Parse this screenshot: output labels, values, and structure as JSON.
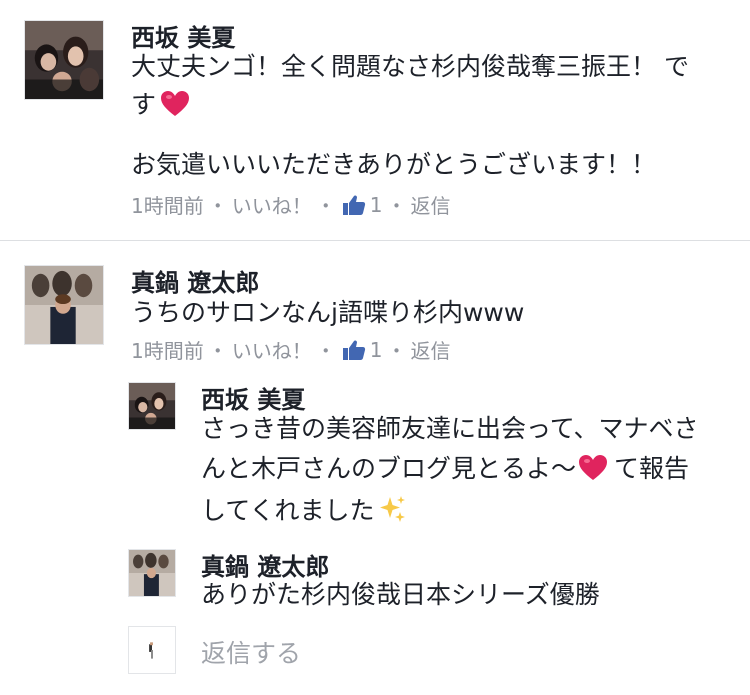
{
  "comments": [
    {
      "author": "西坂 美夏",
      "lines": [
        "大丈夫ンゴ！全く問題なさ杉内俊哉奪三振王！ で",
        "す",
        "お気遣いいいただきありがとうございます！！"
      ],
      "meta": {
        "time": "1時間前",
        "like": "いいね！",
        "like_count": "1",
        "reply": "返信"
      },
      "avatar_icon": "profile-photo"
    },
    {
      "author": "真鍋 遼太郎",
      "lines": [
        "うちのサロンなんj語喋り杉内www"
      ],
      "meta": {
        "time": "1時間前",
        "like": "いいね！",
        "like_count": "1",
        "reply": "返信"
      },
      "avatar_icon": "profile-photo",
      "replies": [
        {
          "author": "西坂 美夏",
          "lines": [
            "さっき昔の美容師友達に出会って、マナベさ",
            "んと木戸さんのブログ見とるよ〜",
            "て報告",
            "してくれました"
          ]
        },
        {
          "author": "真鍋 遼太郎",
          "lines": [
            "ありがた杉内俊哉日本シリーズ優勝"
          ]
        }
      ]
    }
  ],
  "reply_box": {
    "placeholder": "返信する"
  },
  "colors": {
    "meta": "#90949c",
    "like_blue": "#4267b2",
    "heart": "#e0245e",
    "text": "#1d2129"
  }
}
